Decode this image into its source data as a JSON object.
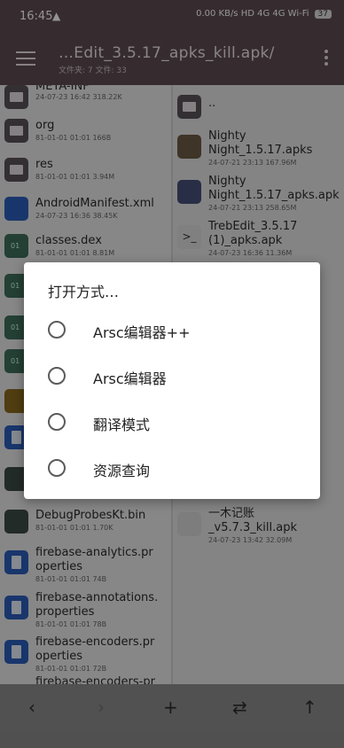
{
  "status": {
    "time": "16:45",
    "icons": "0.00 KB/s  HD  4G  4G  Wi-Fi",
    "battery": "37"
  },
  "appbar": {
    "title": "…Edit_3.5.17_apks_kill.apk/",
    "subtitle": "文件夹: 7  文件: 33",
    "menu_icon": "menu-icon",
    "more_icon": "more-vert-icon"
  },
  "left_pane": [
    {
      "name": "META-INF",
      "meta": "24-07-23 16:42  318.22K",
      "icon": "folder"
    },
    {
      "name": "org",
      "meta": "81-01-01 01:01  166B",
      "icon": "folder"
    },
    {
      "name": "res",
      "meta": "81-01-01 01:01  3.94M",
      "icon": "folder"
    },
    {
      "name": "AndroidManifest.xml",
      "meta": "24-07-23 16:36  38.45K",
      "icon": "xml"
    },
    {
      "name": "classes.dex",
      "meta": "81-01-01 01:01  8.81M",
      "icon": "dex"
    },
    {
      "name": "DebugProbesKt.bin",
      "meta": "81-01-01 01:01  1.70K",
      "icon": "dark"
    },
    {
      "name": "firebase-analytics.pr\noperties",
      "meta": "81-01-01 01:01  74B",
      "icon": "doc"
    },
    {
      "name": "firebase-annotations.\nproperties",
      "meta": "81-01-01 01:01  78B",
      "icon": "doc"
    },
    {
      "name": "firebase-encoders.pr\noperties",
      "meta": "81-01-01 01:01  72B",
      "icon": "doc"
    },
    {
      "name": "firebase-encoders-pr",
      "meta": "",
      "icon": "doc"
    }
  ],
  "right_pane": [
    {
      "name": "..",
      "meta": "",
      "icon": "folder"
    },
    {
      "name": "Nighty\nNight_1.5.17.apks",
      "meta": "24-07-21 23:13  167.96M",
      "icon": "thumb1"
    },
    {
      "name": "Nighty\nNight_1.5.17_apks.apk",
      "meta": "24-07-21 23:13  258.65M",
      "icon": "thumb2"
    },
    {
      "name": "TrebEdit_3.5.17\n(1)_apks.apk",
      "meta": "24-07-23 16:36  11.36M",
      "icon": "term"
    },
    {
      "name": "一木记账\n_v5.7.3_kill.apk",
      "meta": "24-07-23 13:42  32.09M",
      "icon": "apk"
    }
  ],
  "dialog": {
    "title": "打开方式…",
    "options": [
      "Arsc编辑器++",
      "Arsc编辑器",
      "翻译模式",
      "资源查询"
    ]
  },
  "bottom_nav": {
    "back": "‹",
    "forward": "›",
    "add": "+",
    "swap": "⇄",
    "up": "↑"
  },
  "colors": {
    "appbar": "#5e4c52",
    "overlay": "rgba(0,0,0,0.42)"
  }
}
